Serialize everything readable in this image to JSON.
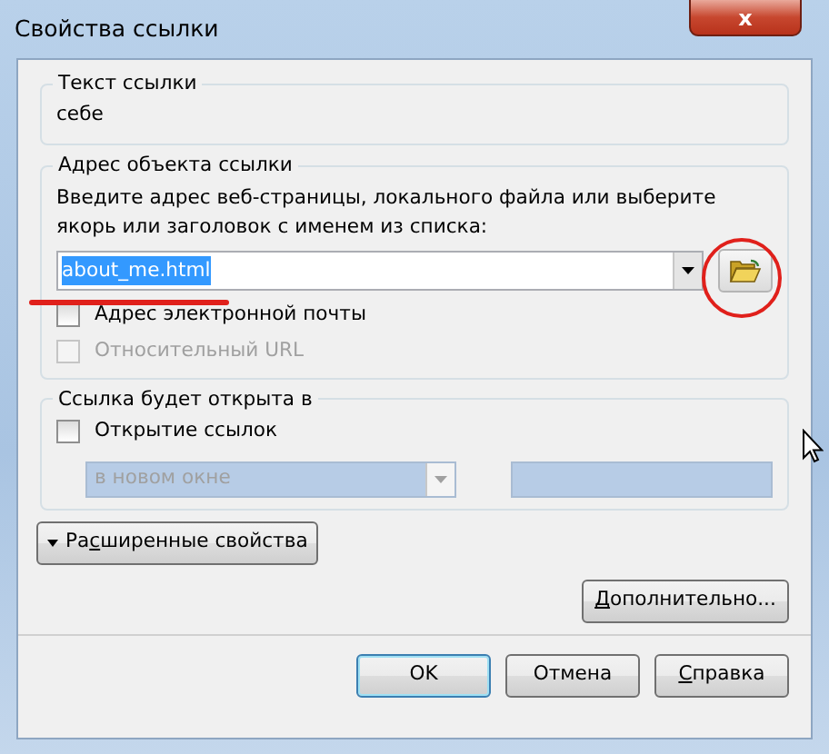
{
  "window": {
    "title": "Свойства ссылки",
    "close_label": "x"
  },
  "link_text_group": {
    "legend": "Текст ссылки",
    "value": "себе"
  },
  "address_group": {
    "legend": "Адрес объекта ссылки",
    "hint": "Введите адрес веб-страницы, локального файла или выберите якорь или заголовок с именем из списка:",
    "address": {
      "value": "about_me.html",
      "selected": true
    },
    "checkboxes": [
      {
        "label": "Адрес электронной почты",
        "checked": false,
        "disabled": false
      },
      {
        "label": "Относительный URL",
        "checked": false,
        "disabled": true
      }
    ]
  },
  "target_group": {
    "legend": "Ссылка будет открыта в",
    "checkbox": {
      "label": "Открытие ссылок",
      "checked": false,
      "disabled": false
    },
    "target_select": {
      "value": "в новом окне",
      "disabled": true
    },
    "target_field": {
      "disabled": true
    }
  },
  "advanced_toggle": {
    "text_before": "Ра",
    "access_key": "с",
    "text_after": "ширенные свойства",
    "expanded": false
  },
  "more_button": {
    "access_key": "Д",
    "text_after": "ополнительно..."
  },
  "buttons": [
    {
      "text_before": "OK",
      "default": true
    },
    {
      "text_before": "Отмена",
      "default": false
    },
    {
      "access_key": "С",
      "text_after": "правка",
      "default": false
    }
  ]
}
